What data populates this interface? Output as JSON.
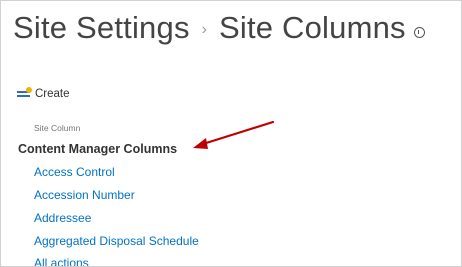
{
  "header": {
    "crumb_1": "Site Settings",
    "separator": "›",
    "crumb_2": "Site Columns"
  },
  "toolbar": {
    "create_label": "Create"
  },
  "list": {
    "column_header": "Site Column",
    "group_name": "Content Manager Columns",
    "items": [
      "Access Control",
      "Accession Number",
      "Addressee",
      "Aggregated Disposal Schedule",
      "All actions"
    ]
  },
  "annotation": {
    "arrow_color": "#c00000"
  },
  "colors": {
    "link": "#0072c6",
    "title": "#444444"
  }
}
